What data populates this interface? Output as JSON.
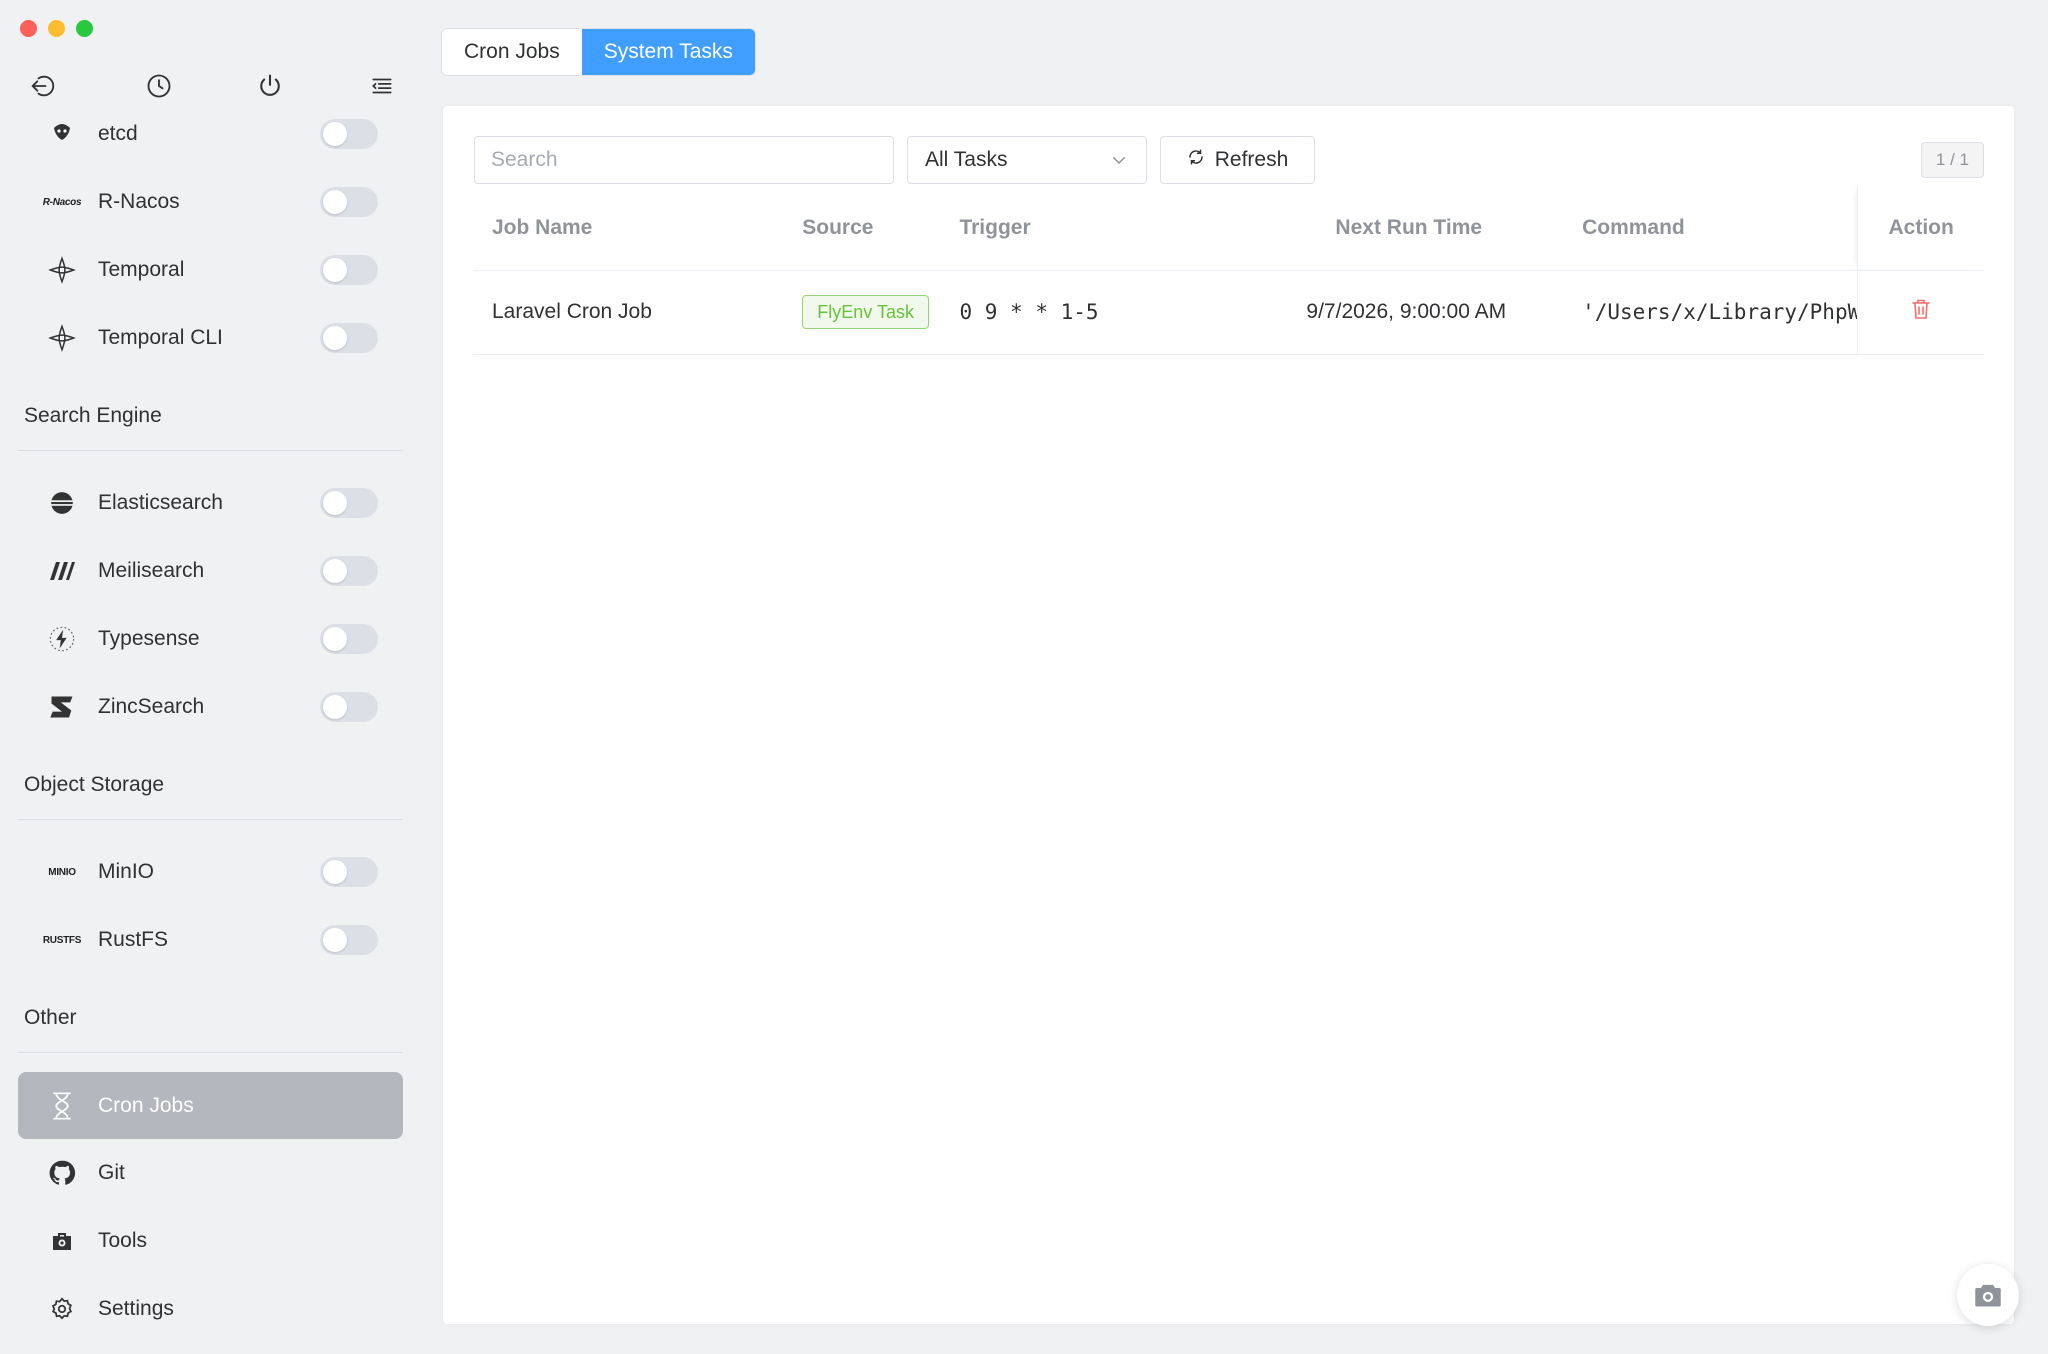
{
  "sidebar": {
    "items": [
      {
        "label": "etcd",
        "icon": "etcd-icon"
      },
      {
        "label": "R-Nacos",
        "icon": "r-nacos-logo",
        "logo_text": "R-Nacos"
      },
      {
        "label": "Temporal",
        "icon": "temporal-icon"
      },
      {
        "label": "Temporal CLI",
        "icon": "temporal-icon"
      },
      {
        "label": "Elasticsearch",
        "icon": "elasticsearch-icon"
      },
      {
        "label": "Meilisearch",
        "icon": "meilisearch-icon"
      },
      {
        "label": "Typesense",
        "icon": "typesense-icon"
      },
      {
        "label": "ZincSearch",
        "icon": "zincsearch-icon"
      },
      {
        "label": "MinIO",
        "icon": "minio-logo",
        "logo_text": "MINIO"
      },
      {
        "label": "RustFS",
        "icon": "rustfs-logo",
        "logo_text": "RUSTFS"
      },
      {
        "label": "Cron Jobs",
        "icon": "hourglass-icon",
        "active": true
      },
      {
        "label": "Git",
        "icon": "github-icon"
      },
      {
        "label": "Tools",
        "icon": "toolbox-icon"
      },
      {
        "label": "Settings",
        "icon": "gear-icon"
      }
    ],
    "sections": {
      "search_engine": "Search Engine",
      "object_storage": "Object Storage",
      "other": "Other"
    }
  },
  "tabs": [
    {
      "label": "Cron Jobs",
      "active": false
    },
    {
      "label": "System Tasks",
      "active": true
    }
  ],
  "toolbar": {
    "search_placeholder": "Search",
    "filter_value": "All Tasks",
    "refresh_label": "Refresh",
    "pager": "1 / 1"
  },
  "table": {
    "columns": {
      "job_name": "Job Name",
      "source": "Source",
      "trigger": "Trigger",
      "next_run": "Next Run Time",
      "command": "Command",
      "action": "Action"
    },
    "rows": [
      {
        "job_name": "Laravel Cron Job",
        "source": "FlyEnv Task",
        "trigger": "0 9 * * 1-5",
        "next_run": "9/7/2026, 9:00:00 AM",
        "command": "'/Users/x/Library/PhpWebStu"
      }
    ]
  },
  "colors": {
    "accent": "#409eff",
    "active_sidebar": "#b4b7bd",
    "tag_green": "#67c23a",
    "danger": "#f56c6c"
  }
}
